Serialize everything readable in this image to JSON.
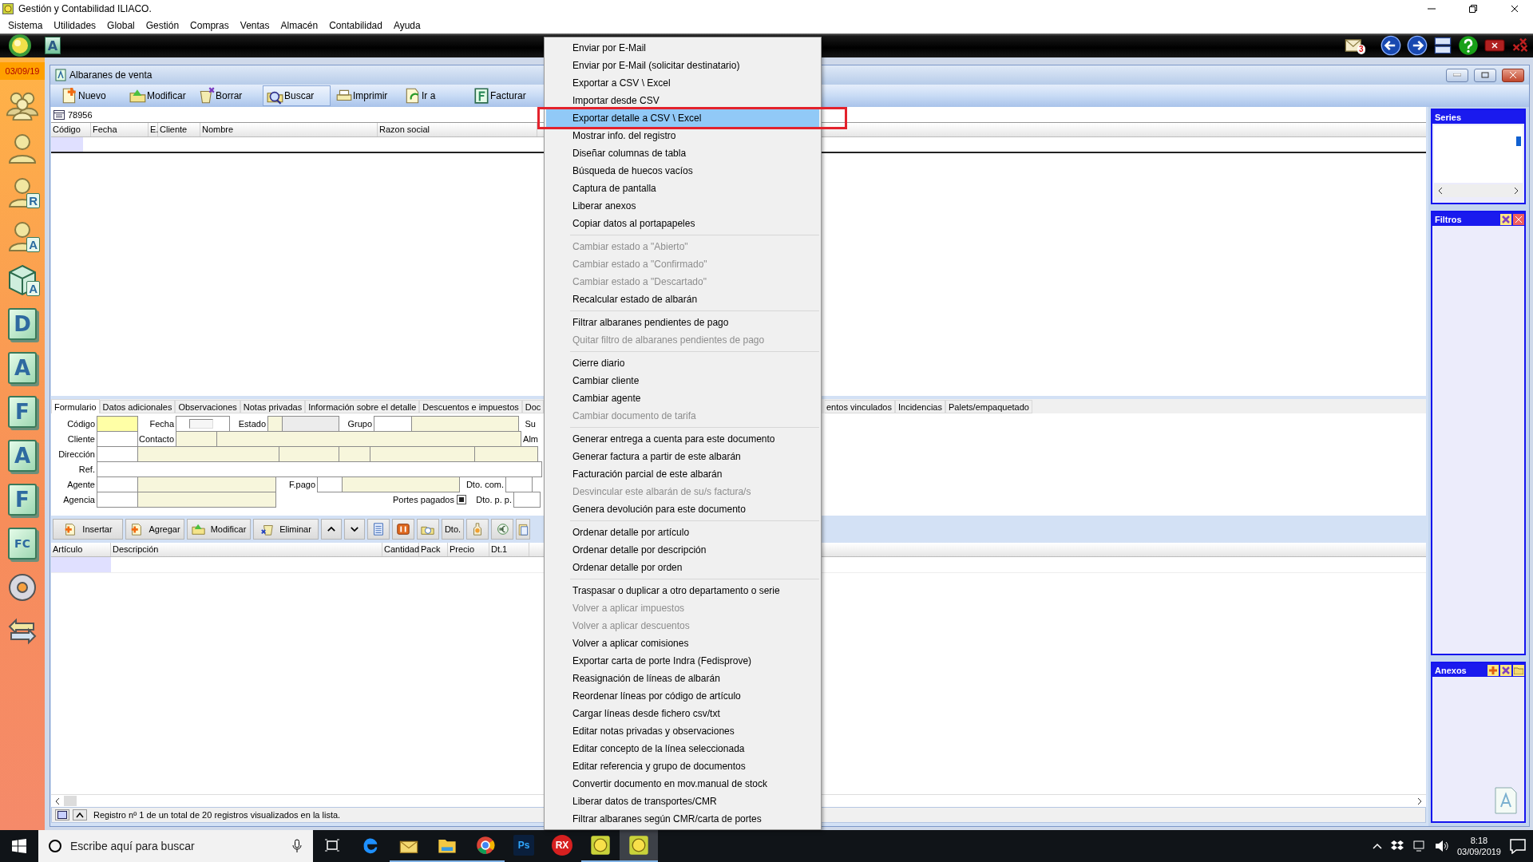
{
  "app": {
    "title": "Gestión y Contabilidad ILIACO."
  },
  "menu_bar": [
    "Sistema",
    "Utilidades",
    "Global",
    "Gestión",
    "Compras",
    "Ventas",
    "Almacén",
    "Contabilidad",
    "Ayuda"
  ],
  "dark_bar": {
    "tile": "A",
    "mail_badge": "3"
  },
  "date": "03/09/19",
  "sidebar": [
    {
      "kind": "people"
    },
    {
      "kind": "person"
    },
    {
      "kind": "person",
      "glyph": "R"
    },
    {
      "kind": "person",
      "glyph": "A"
    },
    {
      "kind": "cube",
      "glyph": "A"
    },
    {
      "kind": "letter",
      "glyph": "D"
    },
    {
      "kind": "letter",
      "glyph": "A"
    },
    {
      "kind": "letter",
      "glyph": "F"
    },
    {
      "kind": "letter",
      "glyph": "A"
    },
    {
      "kind": "letter",
      "glyph": "F"
    },
    {
      "kind": "letter",
      "glyph": "FC"
    },
    {
      "kind": "disc"
    },
    {
      "kind": "arrows"
    }
  ],
  "window": {
    "title": "Albaranes de venta"
  },
  "toolbar": [
    {
      "label": "Nuevo",
      "selected": false
    },
    {
      "label": "Modificar",
      "selected": false
    },
    {
      "label": "Borrar",
      "selected": false
    },
    {
      "label": "Buscar",
      "selected": true
    },
    {
      "label": "Imprimir",
      "selected": false
    },
    {
      "label": "Ir a",
      "selected": false
    },
    {
      "label": "Facturar",
      "selected": false
    }
  ],
  "search": {
    "value": "78956"
  },
  "list_columns": [
    "Código",
    "Fecha",
    "E.",
    "Cliente",
    "Nombre",
    "Razon social"
  ],
  "tabs": [
    {
      "label": "Formulario",
      "selected": true
    },
    {
      "label": "Datos adicionales",
      "selected": false
    },
    {
      "label": "Observaciones",
      "selected": false
    },
    {
      "label": "Notas privadas",
      "selected": false
    },
    {
      "label": "Información sobre el detalle",
      "selected": false
    },
    {
      "label": "Descuentos e impuestos",
      "selected": false
    },
    {
      "label": "Doc",
      "selected": false
    }
  ],
  "tabs_after_menu": [
    {
      "label": "entos vinculados",
      "selected": false
    },
    {
      "label": "Incidencias",
      "selected": false
    },
    {
      "label": "Palets/empaquetado",
      "selected": false
    }
  ],
  "form": [
    [
      {
        "kind": "label",
        "text": "Código"
      },
      {
        "kind": "required"
      },
      {
        "kind": "label",
        "text": "Fecha"
      },
      {
        "kind": "date"
      },
      {
        "kind": "label",
        "text": "Estado"
      },
      {
        "kind": "readonly"
      },
      {
        "kind": "disabled"
      },
      {
        "kind": "label",
        "text": "Grupo"
      },
      {
        "kind": "input"
      },
      {
        "kind": "readonly"
      },
      {
        "kind": "label",
        "text": "Su"
      }
    ],
    [
      {
        "kind": "label",
        "text": "Cliente"
      },
      {
        "kind": "input"
      },
      {
        "kind": "label",
        "text": "Contacto"
      },
      {
        "kind": "readonly"
      },
      {
        "kind": "readonly"
      },
      {
        "kind": "label",
        "text": "Alm"
      }
    ],
    [
      {
        "kind": "label",
        "text": "Dirección"
      },
      {
        "kind": "input"
      },
      {
        "kind": "readonly"
      },
      {
        "kind": "readonly"
      },
      {
        "kind": "readonly"
      },
      {
        "kind": "readonly"
      },
      {
        "kind": "readonly"
      }
    ],
    [
      {
        "kind": "label",
        "text": "Ref."
      },
      {
        "kind": "input"
      }
    ],
    [
      {
        "kind": "label",
        "text": "Agente"
      },
      {
        "kind": "input"
      },
      {
        "kind": "readonly"
      },
      {
        "kind": "label",
        "text": "F.pago"
      },
      {
        "kind": "input"
      },
      {
        "kind": "readonly"
      },
      {
        "kind": "label",
        "text": "Dto. com."
      },
      {
        "kind": "input"
      }
    ],
    [
      {
        "kind": "label",
        "text": "Agencia"
      },
      {
        "kind": "input"
      },
      {
        "kind": "readonly"
      },
      {
        "kind": "label",
        "text": "Portes pagados"
      },
      {
        "kind": "check",
        "checked": true
      },
      {
        "kind": "label",
        "text": "Dto. p. p."
      },
      {
        "kind": "input"
      }
    ]
  ],
  "detail_toolbar": [
    {
      "kind": "text",
      "label": "Insertar"
    },
    {
      "kind": "text",
      "label": "Agregar"
    },
    {
      "kind": "text",
      "label": "Modificar"
    },
    {
      "kind": "text",
      "label": "Eliminar"
    },
    {
      "kind": "icon"
    },
    {
      "kind": "icon"
    },
    {
      "kind": "icon"
    },
    {
      "kind": "icon"
    },
    {
      "kind": "icon"
    },
    {
      "kind": "text",
      "label": "Dto."
    },
    {
      "kind": "icon"
    },
    {
      "kind": "icon"
    },
    {
      "kind": "icon"
    }
  ],
  "detail_columns": [
    "Artículo",
    "Descripción",
    "Cantidad",
    "Pack",
    "Precio",
    "Dt.1"
  ],
  "status": "Registro nº 1 de un total de 20 registros visualizados en la lista.",
  "panels": [
    {
      "title": "Series"
    },
    {
      "title": "Filtros"
    },
    {
      "title": "Anexos"
    }
  ],
  "context_menu": [
    {
      "kind": "item",
      "label": "Enviar por E-Mail",
      "disabled": false,
      "selected": false
    },
    {
      "kind": "item",
      "label": "Enviar por E-Mail (solicitar destinatario)",
      "disabled": false,
      "selected": false
    },
    {
      "kind": "item",
      "label": "Exportar a CSV \\ Excel",
      "disabled": false,
      "selected": false
    },
    {
      "kind": "item",
      "label": "Importar desde CSV",
      "disabled": false,
      "selected": false
    },
    {
      "kind": "item",
      "label": "Exportar detalle a CSV \\ Excel",
      "disabled": false,
      "selected": true
    },
    {
      "kind": "item",
      "label": "Mostrar info. del registro",
      "disabled": false,
      "selected": false
    },
    {
      "kind": "item",
      "label": "Diseñar columnas de tabla",
      "disabled": false,
      "selected": false
    },
    {
      "kind": "item",
      "label": "Búsqueda de huecos vacíos",
      "disabled": false,
      "selected": false
    },
    {
      "kind": "item",
      "label": "Captura de pantalla",
      "disabled": false,
      "selected": false
    },
    {
      "kind": "item",
      "label": "Liberar anexos",
      "disabled": false,
      "selected": false
    },
    {
      "kind": "item",
      "label": "Copiar datos al portapapeles",
      "disabled": false,
      "selected": false
    },
    {
      "kind": "separator"
    },
    {
      "kind": "item",
      "label": "Cambiar estado a \"Abierto\"",
      "disabled": true,
      "selected": false
    },
    {
      "kind": "item",
      "label": "Cambiar estado a \"Confirmado\"",
      "disabled": true,
      "selected": false
    },
    {
      "kind": "item",
      "label": "Cambiar estado a \"Descartado\"",
      "disabled": true,
      "selected": false
    },
    {
      "kind": "item",
      "label": "Recalcular estado de albarán",
      "disabled": false,
      "selected": false
    },
    {
      "kind": "separator"
    },
    {
      "kind": "item",
      "label": "Filtrar albaranes pendientes de pago",
      "disabled": false,
      "selected": false
    },
    {
      "kind": "item",
      "label": "Quitar filtro de albaranes pendientes de pago",
      "disabled": true,
      "selected": false
    },
    {
      "kind": "separator"
    },
    {
      "kind": "item",
      "label": "Cierre diario",
      "disabled": false,
      "selected": false
    },
    {
      "kind": "item",
      "label": "Cambiar cliente",
      "disabled": false,
      "selected": false
    },
    {
      "kind": "item",
      "label": "Cambiar agente",
      "disabled": false,
      "selected": false
    },
    {
      "kind": "item",
      "label": "Cambiar documento de tarifa",
      "disabled": true,
      "selected": false
    },
    {
      "kind": "separator"
    },
    {
      "kind": "item",
      "label": "Generar entrega a cuenta para este documento",
      "disabled": false,
      "selected": false
    },
    {
      "kind": "item",
      "label": "Generar factura a partir de este albarán",
      "disabled": false,
      "selected": false
    },
    {
      "kind": "item",
      "label": "Facturación parcial de este albarán",
      "disabled": false,
      "selected": false
    },
    {
      "kind": "item",
      "label": "Desvincular este albarán de su/s factura/s",
      "disabled": true,
      "selected": false
    },
    {
      "kind": "item",
      "label": "Genera devolución para este documento",
      "disabled": false,
      "selected": false
    },
    {
      "kind": "separator"
    },
    {
      "kind": "item",
      "label": "Ordenar detalle por artículo",
      "disabled": false,
      "selected": false
    },
    {
      "kind": "item",
      "label": "Ordenar detalle por descripción",
      "disabled": false,
      "selected": false
    },
    {
      "kind": "item",
      "label": "Ordenar detalle por orden",
      "disabled": false,
      "selected": false
    },
    {
      "kind": "separator"
    },
    {
      "kind": "item",
      "label": "Traspasar  o duplicar a otro departamento o serie",
      "disabled": false,
      "selected": false
    },
    {
      "kind": "item",
      "label": "Volver a aplicar impuestos",
      "disabled": true,
      "selected": false
    },
    {
      "kind": "item",
      "label": "Volver a aplicar descuentos",
      "disabled": true,
      "selected": false
    },
    {
      "kind": "item",
      "label": "Volver a aplicar comisiones",
      "disabled": false,
      "selected": false
    },
    {
      "kind": "item",
      "label": "Exportar carta de porte Indra (Fedisprove)",
      "disabled": false,
      "selected": false
    },
    {
      "kind": "item",
      "label": "Reasignación de líneas de albarán",
      "disabled": false,
      "selected": false
    },
    {
      "kind": "item",
      "label": "Reordenar líneas por código de artículo",
      "disabled": false,
      "selected": false
    },
    {
      "kind": "item",
      "label": "Cargar líneas desde fichero csv/txt",
      "disabled": false,
      "selected": false
    },
    {
      "kind": "item",
      "label": "Editar notas privadas y observaciones",
      "disabled": false,
      "selected": false
    },
    {
      "kind": "item",
      "label": "Editar concepto de la línea seleccionada",
      "disabled": false,
      "selected": false
    },
    {
      "kind": "item",
      "label": "Editar referencia y grupo de documentos",
      "disabled": false,
      "selected": false
    },
    {
      "kind": "item",
      "label": "Convertir documento en mov.manual de stock",
      "disabled": false,
      "selected": false
    },
    {
      "kind": "item",
      "label": "Liberar datos de transportes/CMR",
      "disabled": false,
      "selected": false
    },
    {
      "kind": "item",
      "label": "Filtrar albaranes según CMR/carta de portes",
      "disabled": false,
      "selected": false
    }
  ],
  "taskbar": {
    "search_placeholder": "Escribe aquí para buscar",
    "time": "8:18",
    "date": "03/09/2019",
    "apps": [
      {
        "kind": "edge",
        "open": false,
        "selected": false
      },
      {
        "kind": "mail",
        "open": true,
        "selected": false
      },
      {
        "kind": "folder",
        "open": true,
        "selected": false
      },
      {
        "kind": "chrome",
        "open": true,
        "selected": false
      },
      {
        "kind": "ps",
        "glyph": "Ps",
        "open": false,
        "selected": false
      },
      {
        "kind": "rx",
        "glyph": "RX",
        "open": false,
        "selected": false
      },
      {
        "kind": "iliaco",
        "open": true,
        "selected": false
      },
      {
        "kind": "iliaco",
        "open": true,
        "selected": true
      }
    ]
  }
}
